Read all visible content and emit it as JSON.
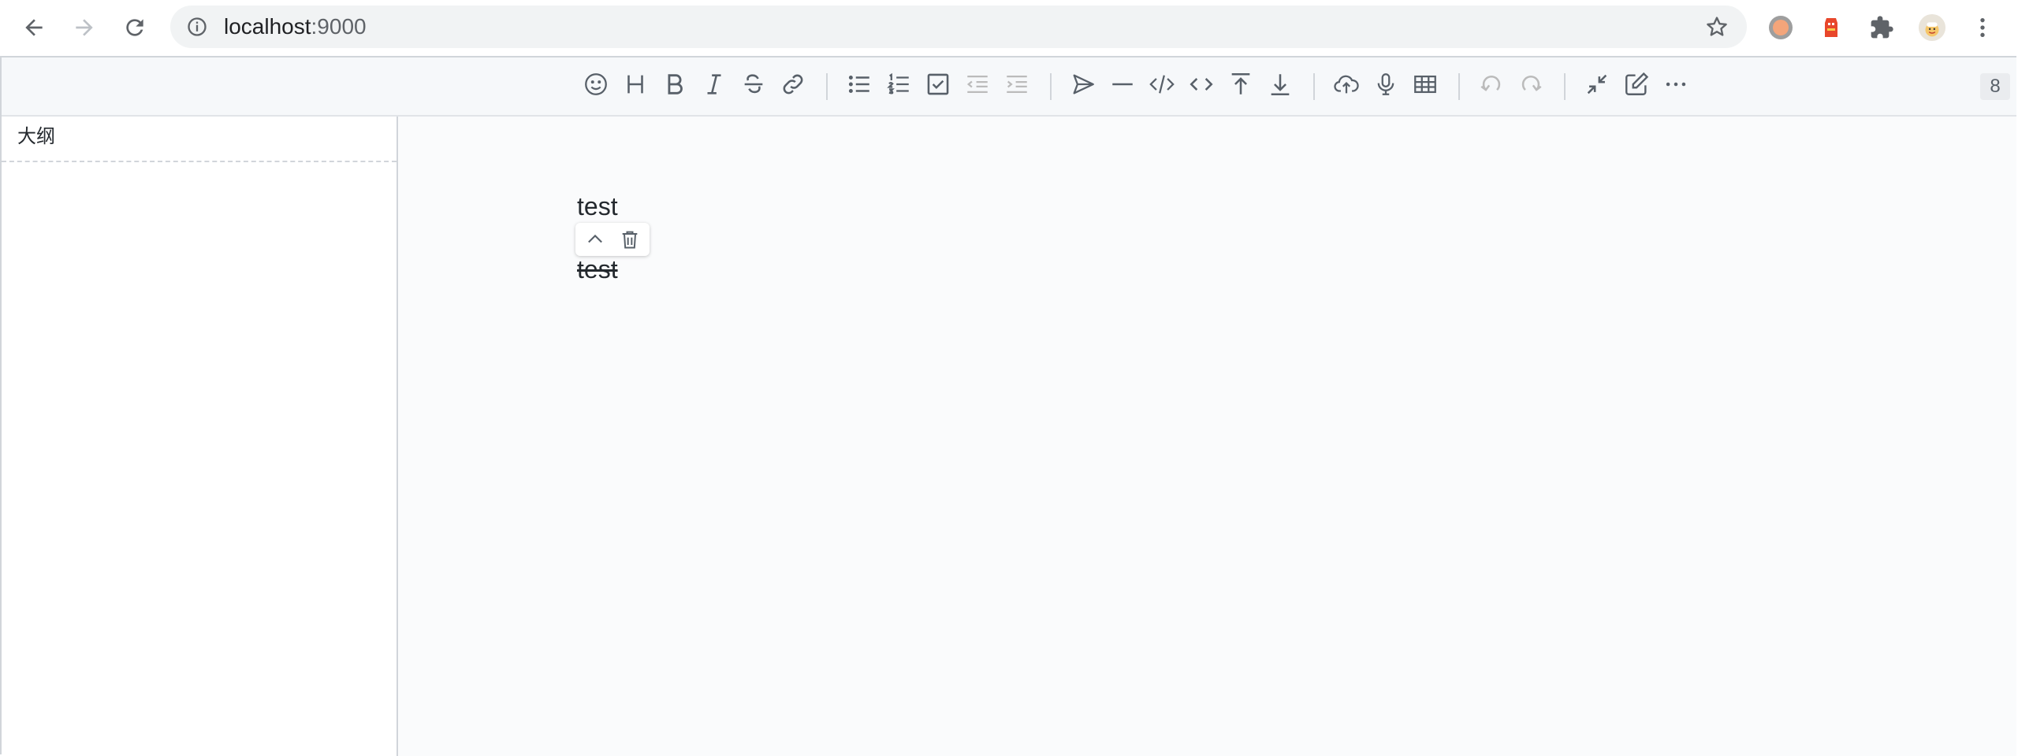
{
  "browser": {
    "url_host": "localhost",
    "url_port": ":9000",
    "nav_icons": [
      "back-arrow-icon",
      "forward-arrow-icon",
      "reload-icon"
    ],
    "omnibox_icons": [
      "info-icon",
      "star-icon"
    ],
    "extension_icons": [
      "orange-circle-extension-icon",
      "red-character-extension-icon",
      "puzzle-extensions-icon",
      "profile-avatar-icon",
      "menu-kebab-icon"
    ]
  },
  "toolbar": {
    "groups": [
      [
        "emoji-icon",
        "heading-icon",
        "bold-icon",
        "italic-icon",
        "strike-icon",
        "link-icon"
      ],
      [
        "unordered-list-icon",
        "ordered-list-icon",
        "check-list-icon",
        "outdent-icon",
        "indent-icon"
      ],
      [
        "quote-send-icon",
        "horizontal-line-icon",
        "code-block-icon",
        "inline-code-icon",
        "insert-before-icon",
        "insert-after-icon"
      ],
      [
        "upload-icon",
        "record-icon",
        "table-icon"
      ],
      [
        "undo-icon",
        "redo-icon"
      ],
      [
        "fullscreen-exit-icon",
        "edit-mode-icon",
        "more-icon"
      ]
    ],
    "counter": "8"
  },
  "outline": {
    "title": "大纲"
  },
  "content": {
    "paragraphs": [
      {
        "text": "test",
        "strikethrough": false
      },
      {
        "text": "test",
        "strikethrough": true
      }
    ],
    "popover_icons": [
      "move-up-icon",
      "delete-icon"
    ]
  },
  "colors": {
    "toolbar_icon": "#586069",
    "disabled_icon": "#bbbbbb",
    "text": "#24292e",
    "border": "#d1d5da"
  }
}
